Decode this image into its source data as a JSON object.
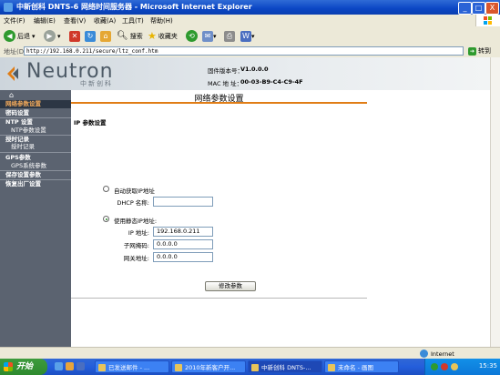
{
  "window": {
    "title": "中新创科 DNTS-6 网络时间服务器 - Microsoft Internet Explorer",
    "controls": {
      "minimize": "_",
      "maximize": "□",
      "close": "X"
    }
  },
  "menu": {
    "items": [
      "文件(F)",
      "编辑(E)",
      "查看(V)",
      "收藏(A)",
      "工具(T)",
      "帮助(H)"
    ]
  },
  "toolbar": {
    "back_label": "后退",
    "search_label": "搜索",
    "favorites_label": "收藏夹"
  },
  "address": {
    "label": "地址(D)",
    "url": "http://192.168.0.211/secure/ltz_conf.htm",
    "go_label": "转到"
  },
  "header": {
    "logo_text": "Neutron",
    "logo_sub": "中新创科",
    "firmware_label": "固件版本号：",
    "firmware_value": "V1.0.0.0",
    "mac_label": "MAC 地 址：",
    "mac_value": "00-03-B9-C4-C9-4F"
  },
  "sidebar": {
    "home": "⌂",
    "items": [
      {
        "label": "网络参数设置",
        "active": true
      },
      {
        "label": "密码设置"
      },
      {
        "label": "NTP 设置"
      },
      {
        "label": "NTP参数设置",
        "sub": true
      },
      {
        "label": "授时记录"
      },
      {
        "label": "授时记录",
        "sub": true
      },
      {
        "label": "GPS参数"
      },
      {
        "label": "GPS系统参数",
        "sub": true
      },
      {
        "label": "保存设置参数"
      },
      {
        "label": "恢复出厂设置"
      }
    ]
  },
  "form": {
    "page_title": "网络参数设置",
    "section_title": "IP 参数设置",
    "auto_ip_label": "自动获取IP地址",
    "dhcp_label": "DHCP 名称:",
    "dhcp_value": "",
    "static_ip_label": "使用静态IP地址:",
    "ip_label": "IP 地址:",
    "ip_value": "192.168.0.211",
    "mask_label": "子网掩码:",
    "mask_value": "0.0.0.0",
    "gateway_label": "网关地址:",
    "gateway_value": "0.0.0.0",
    "submit_label": "修改参数",
    "selected_mode": "static"
  },
  "status": {
    "zone": "Internet"
  },
  "taskbar": {
    "start": "开始",
    "tasks": [
      {
        "label": "已发送邮件 - ...",
        "active": false
      },
      {
        "label": "2010年新客户开...",
        "active": false
      },
      {
        "label": "中新创科 DNTS-...",
        "active": true
      },
      {
        "label": "未命名 - 画图",
        "active": false
      }
    ],
    "clock": "15:35"
  },
  "colors": {
    "accent_orange": "#e07d16",
    "sidebar_bg": "#5b6370",
    "xp_blue": "#0b46c4"
  }
}
